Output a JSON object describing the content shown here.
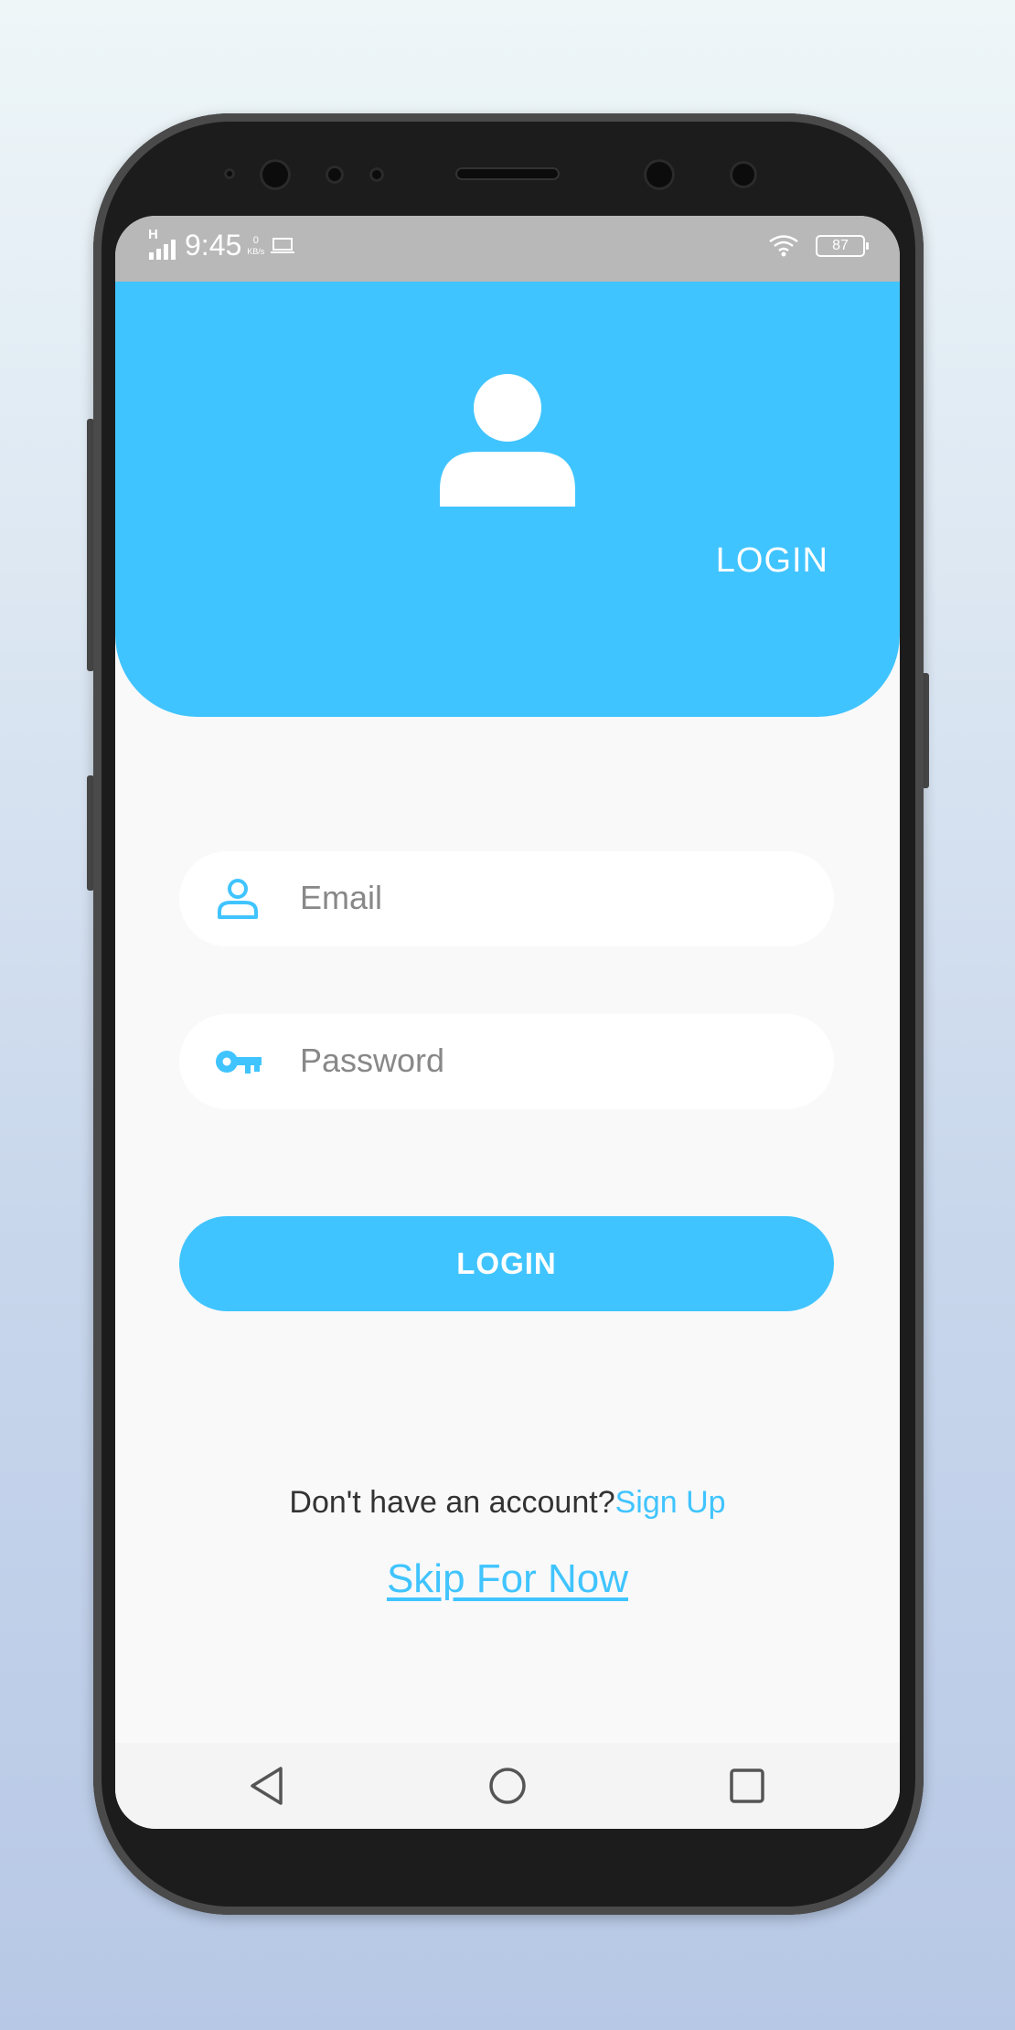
{
  "status_bar": {
    "network": "H",
    "time": "9:45",
    "data_rate_value": "0",
    "data_rate_unit": "KB/s",
    "battery": "87"
  },
  "header": {
    "title": "LOGIN",
    "icon": "user-avatar-icon",
    "color": "#40c4ff"
  },
  "form": {
    "email": {
      "placeholder": "Email",
      "value": "",
      "icon": "person-icon"
    },
    "password": {
      "placeholder": "Password",
      "value": "",
      "icon": "key-icon"
    },
    "submit_label": "LOGIN"
  },
  "footer": {
    "account_prompt": "Don't have an account?",
    "signup_label": "Sign Up",
    "skip_label": "Skip For Now"
  },
  "nav": {
    "back_icon": "back-triangle-icon",
    "home_icon": "home-circle-icon",
    "recent_icon": "recents-square-icon"
  },
  "colors": {
    "accent": "#40c4ff",
    "status_bar": "#b8b8b8",
    "screen_bg": "#f9f9f9"
  }
}
